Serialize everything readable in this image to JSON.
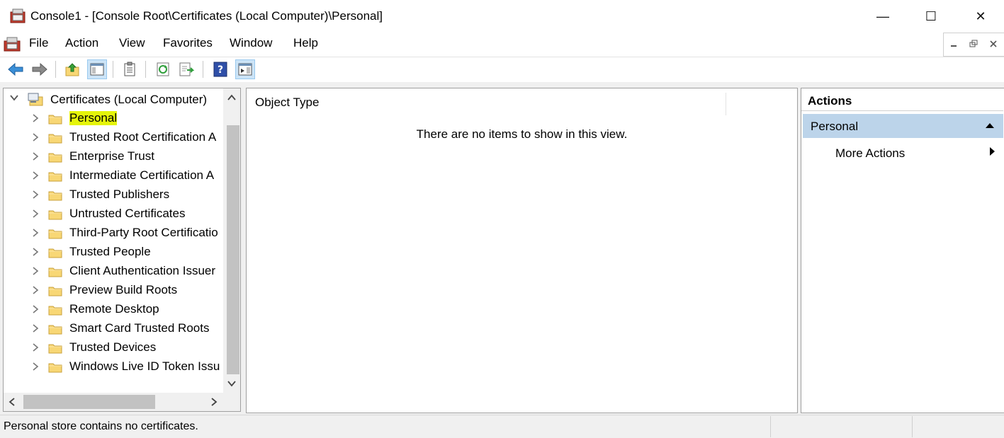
{
  "window": {
    "title": "Console1 - [Console Root\\Certificates (Local Computer)\\Personal]",
    "minimize_glyph": "—",
    "maximize_glyph": "☐",
    "close_glyph": "✕"
  },
  "menu": {
    "items": [
      {
        "label": "File"
      },
      {
        "label": "Action"
      },
      {
        "label": "View"
      },
      {
        "label": "Favorites"
      },
      {
        "label": "Window"
      },
      {
        "label": "Help"
      }
    ]
  },
  "toolbar": {
    "buttons": [
      "back-icon",
      "forward-icon",
      "up-one-level-icon",
      "show-hide-console-tree-icon",
      "properties-icon",
      "refresh-icon",
      "export-list-icon",
      "help-icon",
      "show-hide-action-pane-icon"
    ]
  },
  "tree": {
    "root": "Certificates (Local Computer)",
    "items": [
      {
        "label": "Personal",
        "selected": true
      },
      {
        "label": "Trusted Root Certification A"
      },
      {
        "label": "Enterprise Trust"
      },
      {
        "label": "Intermediate Certification A"
      },
      {
        "label": "Trusted Publishers"
      },
      {
        "label": "Untrusted Certificates"
      },
      {
        "label": "Third-Party Root Certificatio"
      },
      {
        "label": "Trusted People"
      },
      {
        "label": "Client Authentication Issuer"
      },
      {
        "label": "Preview Build Roots"
      },
      {
        "label": "Remote Desktop"
      },
      {
        "label": "Smart Card Trusted Roots"
      },
      {
        "label": "Trusted Devices"
      },
      {
        "label": "Windows Live ID Token Issu"
      }
    ]
  },
  "content": {
    "column_header": "Object Type",
    "empty_message": "There are no items to show in this view."
  },
  "actions": {
    "title": "Actions",
    "section": "Personal",
    "more_actions": "More Actions"
  },
  "status": {
    "text": "Personal store contains no certificates."
  },
  "colors": {
    "selection_highlight": "#e5f50a",
    "actions_section_bg": "#bcd4ea",
    "toolbar_active_bg": "#cce4f7",
    "folder_fill": "#f8d775",
    "folder_stroke": "#c9a13c"
  }
}
